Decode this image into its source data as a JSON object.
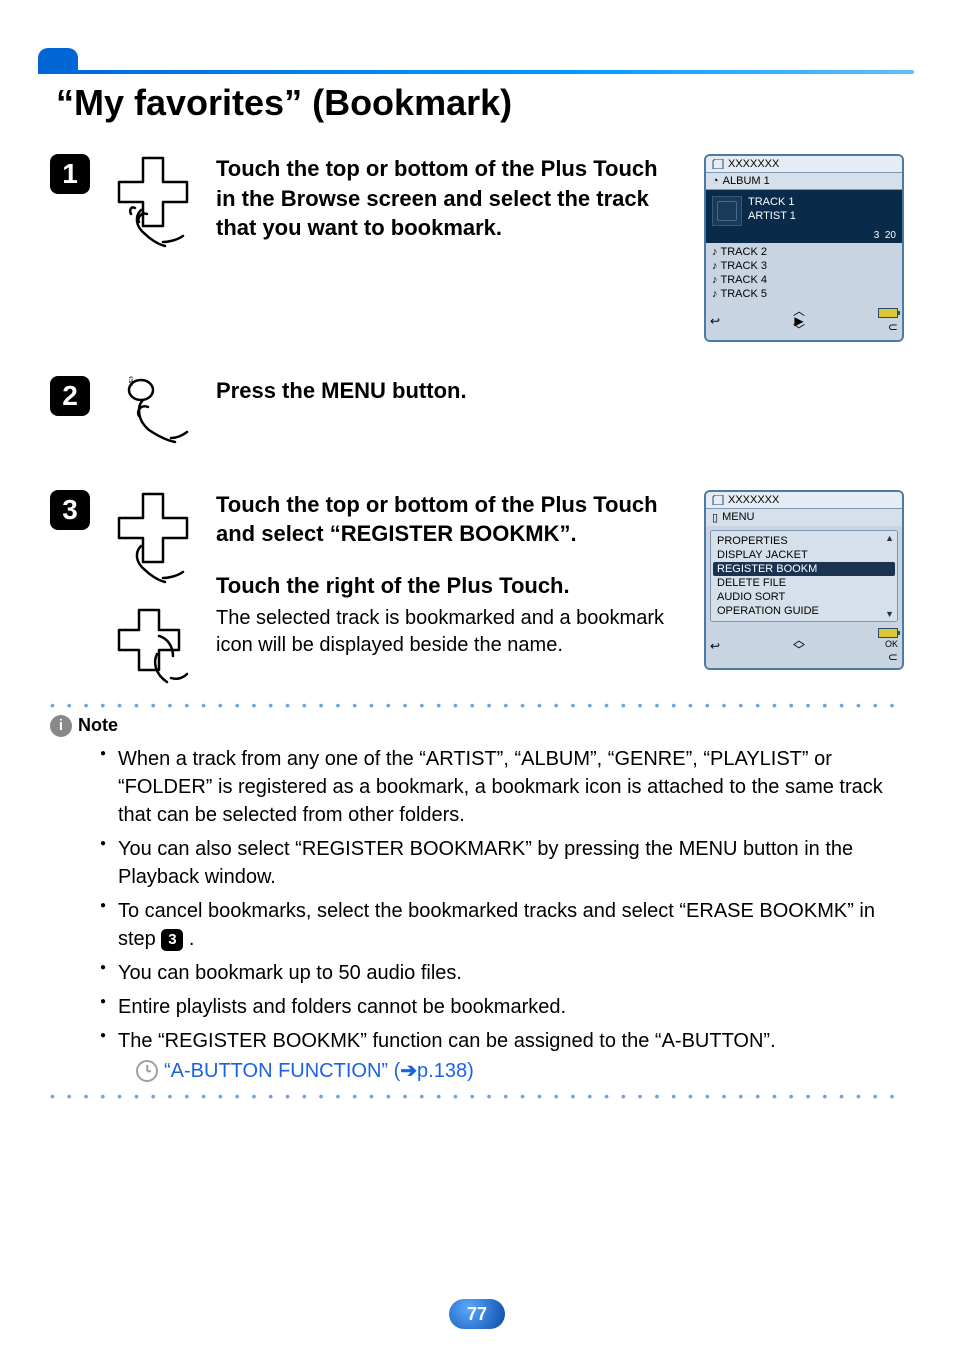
{
  "title": "“My favorites” (Bookmark)",
  "steps": {
    "s1": {
      "num": "1",
      "headline": "Touch the top or bottom of the Plus Touch in the Browse screen and select the track that you want to bookmark."
    },
    "s2": {
      "num": "2",
      "headline": "Press the MENU button."
    },
    "s3": {
      "num": "3",
      "headline": "Touch the top or bottom of the Plus Touch and select “REGISTER BOOKMK”.",
      "sub_headline": "Touch the right of the Plus Touch.",
      "sub_desc": "The selected track is bookmarked and a bookmark icon will be displayed beside the name."
    }
  },
  "screen1": {
    "title": "XXXXXXX",
    "subtitle": "ALBUM 1",
    "np_track": "TRACK 1",
    "np_artist": "ARTIST 1",
    "np_index": "3",
    "np_total": "20",
    "tracks": [
      "TRACK 2",
      "TRACK 3",
      "TRACK 4",
      "TRACK 5"
    ]
  },
  "screen2": {
    "title": "XXXXXXX",
    "menu_label": "MENU",
    "items": [
      "PROPERTIES",
      "DISPLAY JACKET",
      "REGISTER BOOKM",
      "DELETE FILE",
      "AUDIO SORT",
      "OPERATION GUIDE"
    ],
    "selected_index": 2,
    "ok": "OK"
  },
  "note": {
    "label": "Note",
    "items": [
      "When a track from any one of the “ARTIST”, “ALBUM”,  “GENRE”, “PLAYLIST” or “FOLDER” is registered as a bookmark, a bookmark icon is attached to the same track that can be selected from other folders.",
      "You can also select “REGISTER BOOKMARK” by pressing the MENU button in the Playback window.",
      "To cancel bookmarks, select the bookmarked tracks and select “ERASE BOOKMK” in step ",
      "You can bookmark up to 50 audio files.",
      "Entire playlists and folders cannot be bookmarked.",
      "The “REGISTER BOOKMK” function can be assigned to the “A-BUTTON”."
    ],
    "step_ref": "3",
    "ref_text": "“A-BUTTON FUNCTION” (",
    "ref_page": "p.138)",
    "ref_arrow": "➔"
  },
  "page_number": "77"
}
